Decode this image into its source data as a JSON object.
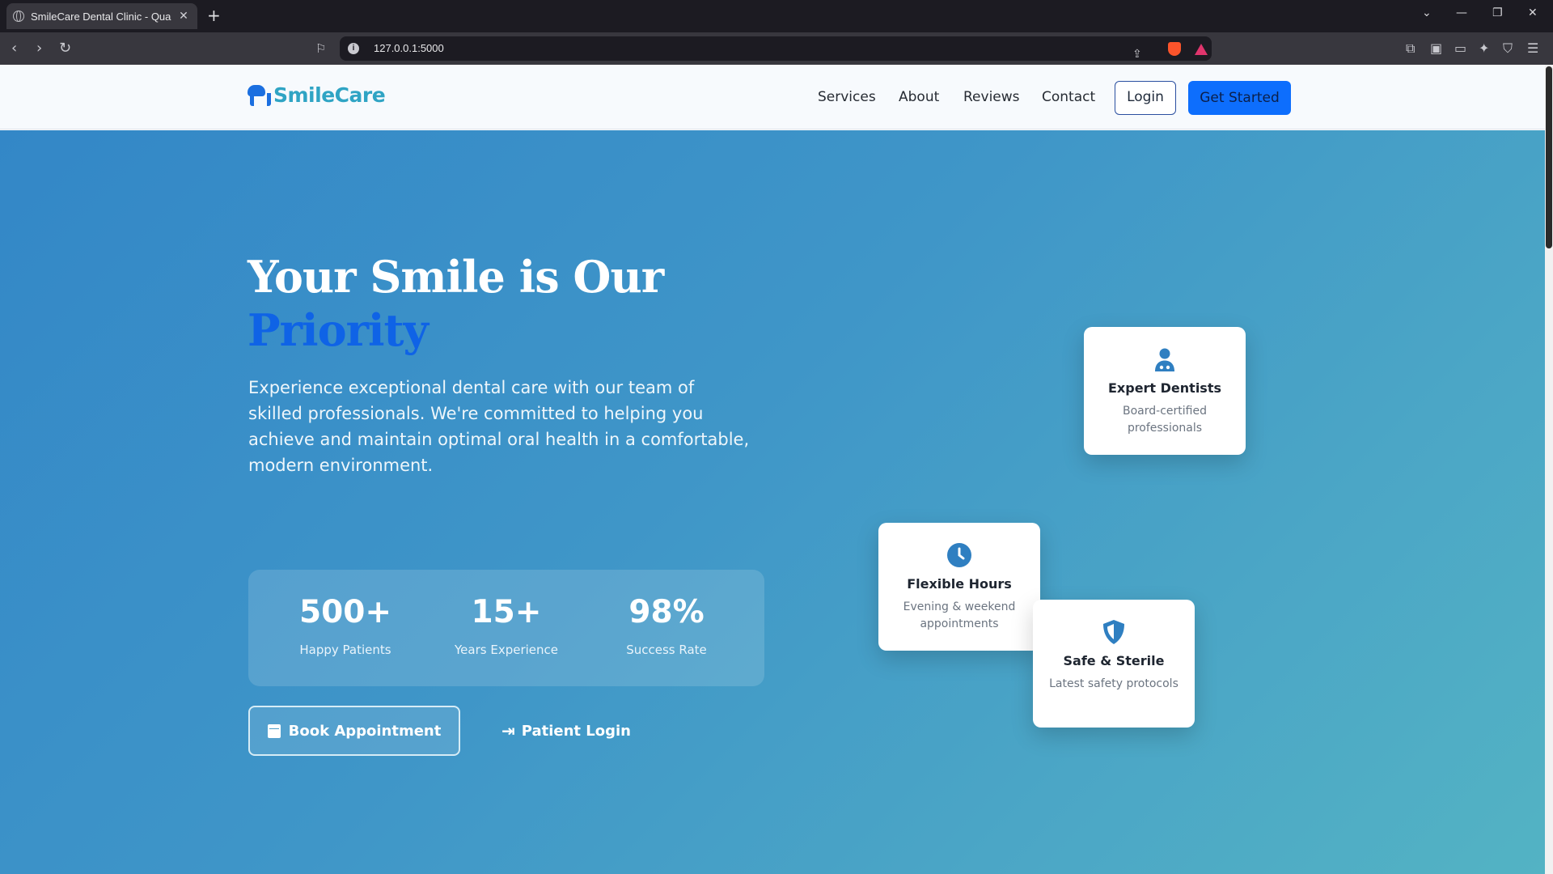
{
  "browser": {
    "tab_title": "SmileCare Dental Clinic - Quality",
    "tab_close": "✕",
    "new_tab": "+",
    "url": "127.0.0.1:5000"
  },
  "site": {
    "brand": "SmileCare",
    "nav": [
      "Services",
      "About",
      "Reviews",
      "Contact"
    ],
    "login": "Login",
    "get_started": "Get Started"
  },
  "hero": {
    "title_line1": "Your Smile is Our",
    "title_accent": "Priority",
    "description": "Experience exceptional dental care with our team of skilled professionals. We're committed to helping you achieve and maintain optimal oral health in a comfortable, modern environment.",
    "stats": [
      {
        "value": "500+",
        "label": "Happy Patients"
      },
      {
        "value": "15+",
        "label": "Years Experience"
      },
      {
        "value": "98%",
        "label": "Success Rate"
      }
    ],
    "book_button": "Book Appointment",
    "patient_login": "Patient Login"
  },
  "cards": [
    {
      "title": "Expert Dentists",
      "desc": "Board-certified professionals",
      "icon": "doctor-icon"
    },
    {
      "title": "Flexible Hours",
      "desc": "Evening & weekend appointments",
      "icon": "clock-icon"
    },
    {
      "title": "Safe & Sterile",
      "desc": "Latest safety protocols",
      "icon": "shield-icon"
    }
  ],
  "colors": {
    "primary": "#0d6efd",
    "brand": "#2fa4c4",
    "accent_text": "#0f63e6",
    "icon": "#2f7fc1"
  }
}
